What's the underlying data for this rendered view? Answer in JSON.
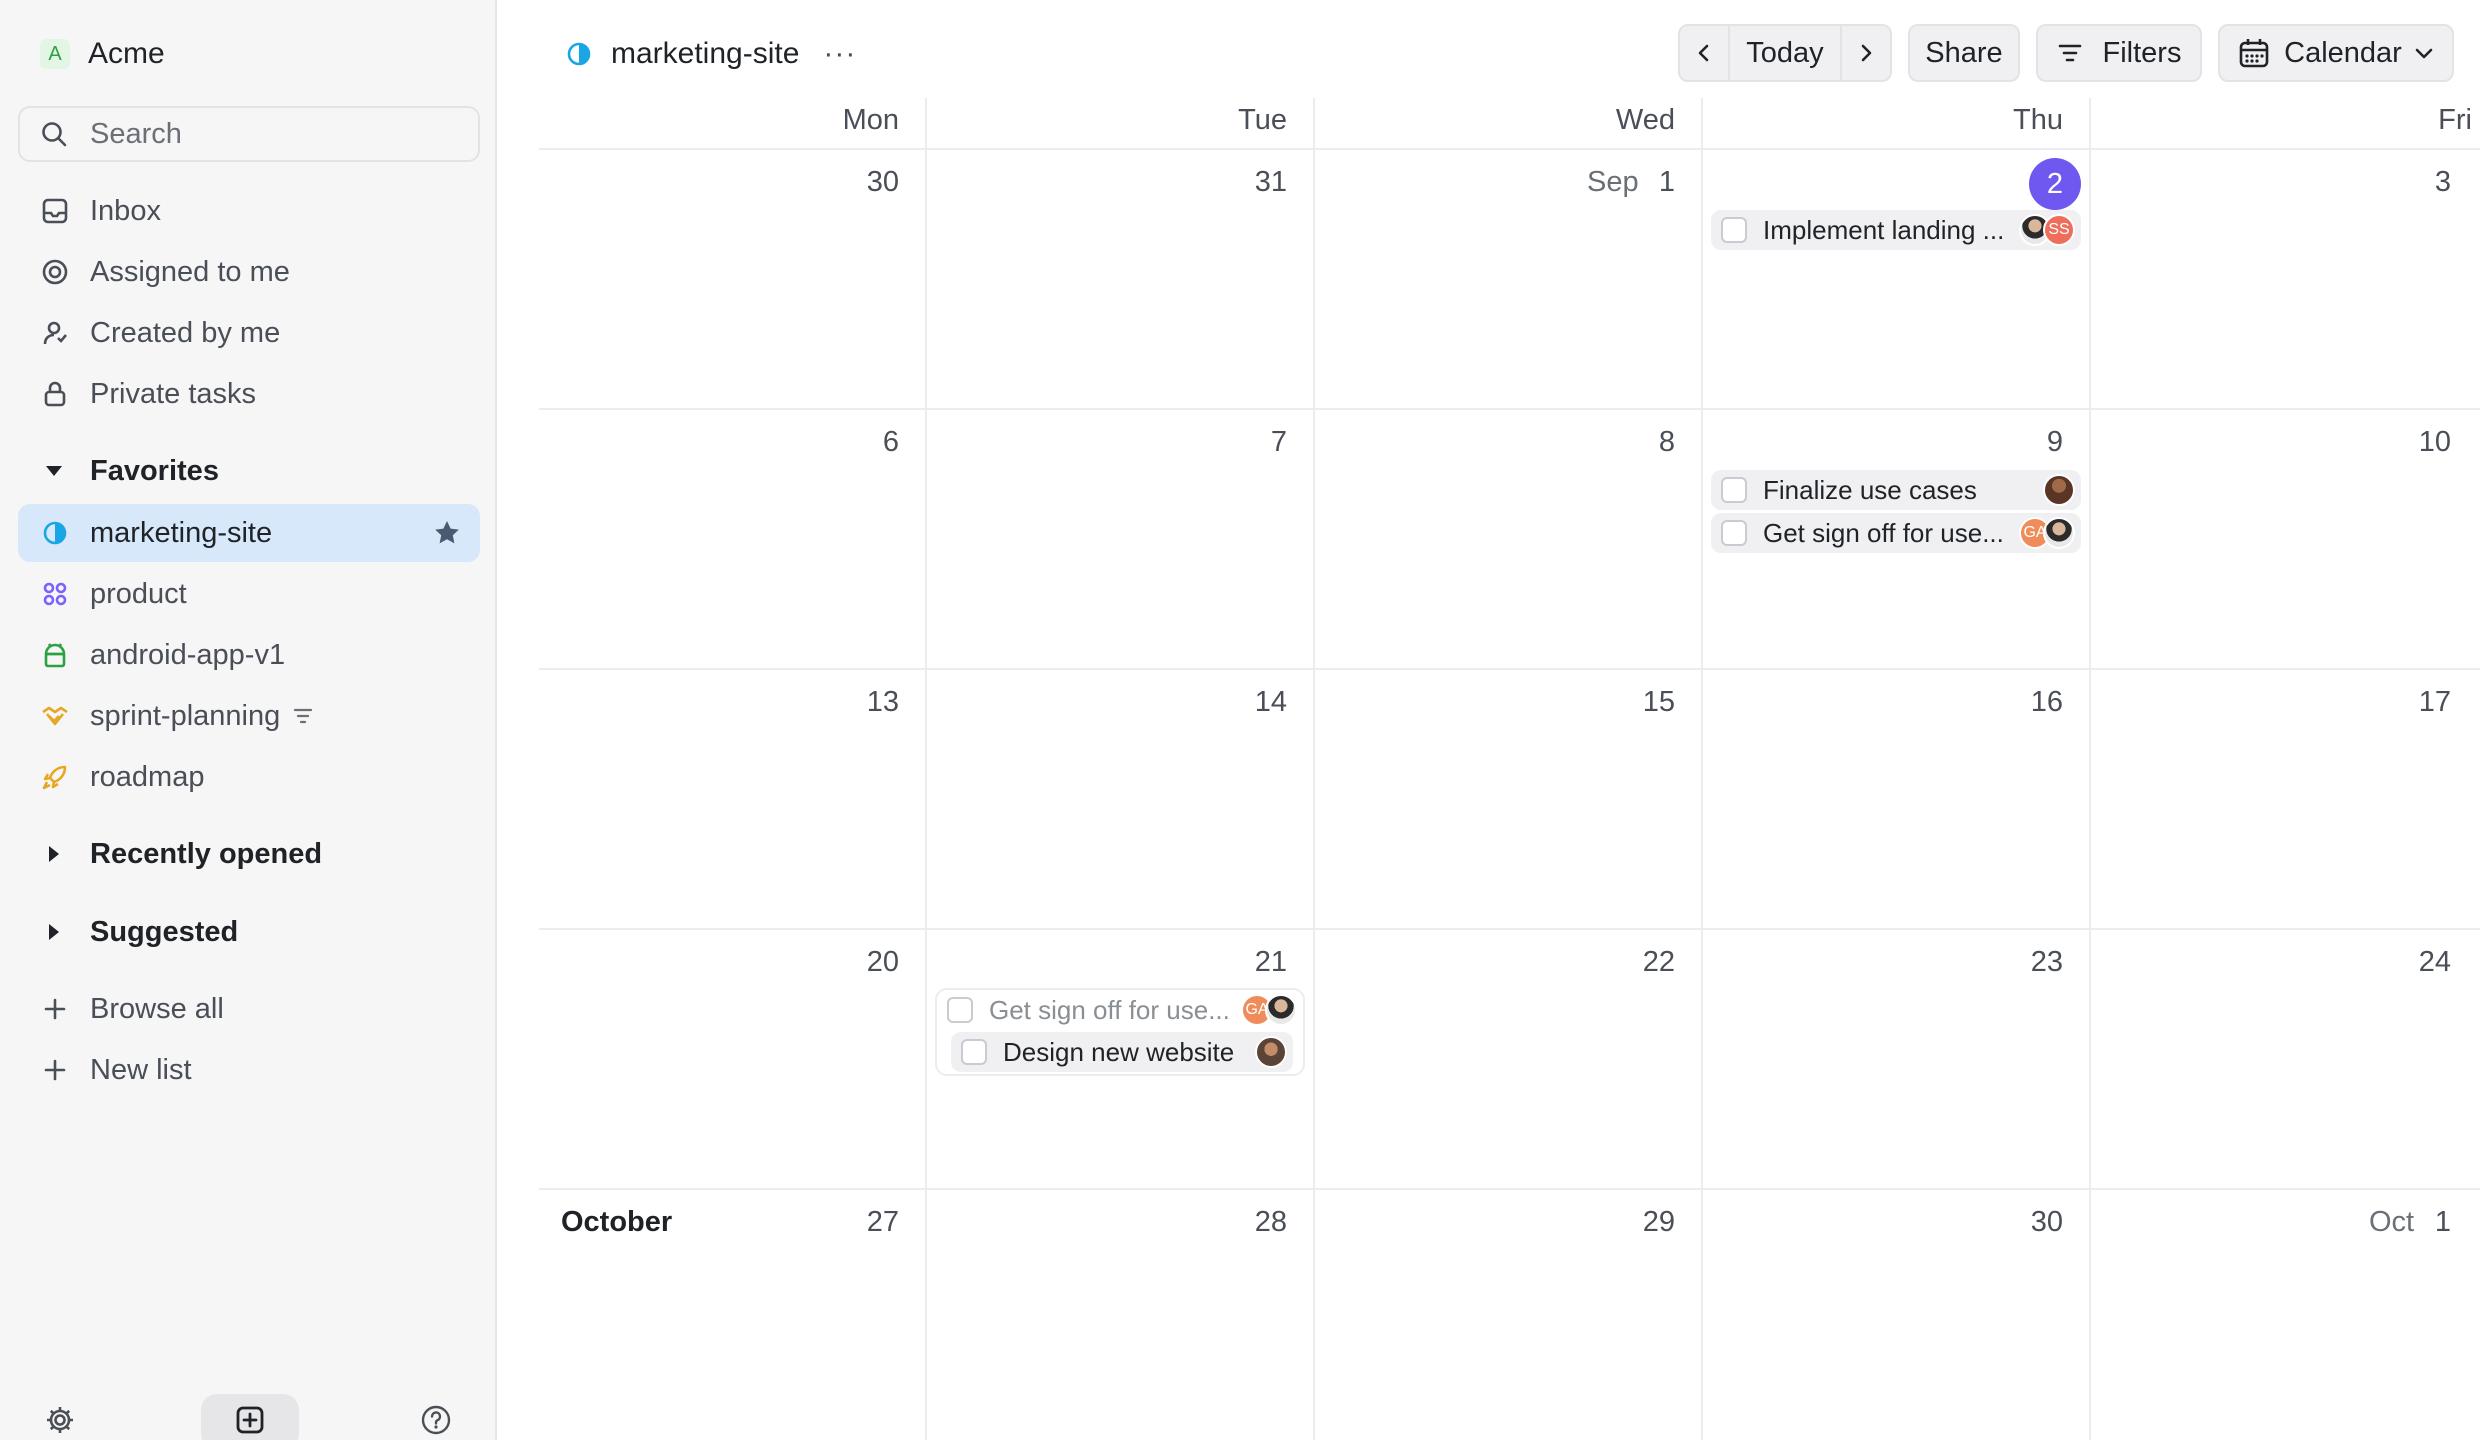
{
  "workspace": {
    "initial": "A",
    "name": "Acme"
  },
  "search": {
    "placeholder": "Search"
  },
  "nav": [
    {
      "label": "Inbox",
      "icon": "inbox-icon"
    },
    {
      "label": "Assigned to me",
      "icon": "target-icon"
    },
    {
      "label": "Created by me",
      "icon": "user-icon"
    },
    {
      "label": "Private tasks",
      "icon": "lock-icon"
    }
  ],
  "favorites": {
    "label": "Favorites",
    "items": [
      {
        "label": "marketing-site",
        "icon": "half-circle-icon",
        "color": "#1aa6e4",
        "active": true
      },
      {
        "label": "product",
        "icon": "grid-icon",
        "color": "#7b61ff"
      },
      {
        "label": "android-app-v1",
        "icon": "android-icon",
        "color": "#2aa243"
      },
      {
        "label": "sprint-planning",
        "icon": "handshake-icon",
        "color": "#e5a823"
      },
      {
        "label": "roadmap",
        "icon": "rocket-icon",
        "color": "#e5a823"
      }
    ]
  },
  "recently_opened": {
    "label": "Recently opened"
  },
  "suggested": {
    "label": "Suggested"
  },
  "actions": {
    "browse_all": "Browse all",
    "new_list": "New list"
  },
  "header": {
    "project": "marketing-site",
    "more": "···",
    "today": "Today",
    "share": "Share",
    "filters": "Filters",
    "view": "Calendar"
  },
  "calendar": {
    "weekdays": [
      "Mon",
      "Tue",
      "Wed",
      "Thu",
      "Fri"
    ],
    "weeks": [
      {
        "days": [
          "30",
          "31",
          "1",
          "2",
          "3"
        ]
      },
      {
        "days": [
          "6",
          "7",
          "8",
          "9",
          "10"
        ]
      },
      {
        "days": [
          "13",
          "14",
          "15",
          "16",
          "17"
        ]
      },
      {
        "days": [
          "20",
          "21",
          "22",
          "23",
          "24"
        ]
      },
      {
        "days": [
          "27",
          "28",
          "29",
          "30",
          "1"
        ]
      }
    ],
    "month_prefix_sep": "Sep",
    "month_prefix_oct": "Oct",
    "month_label_october": "October",
    "today_accent": "#6e58f0"
  },
  "tasks": {
    "implement_landing": {
      "title": "Implement landing ...",
      "avatars": [
        "photo",
        "SS"
      ]
    },
    "finalize_use_cases": {
      "title": "Finalize use cases",
      "avatars": [
        "photo"
      ]
    },
    "get_sign_off_thu": {
      "title": "Get sign off for use...",
      "avatars": [
        "GA",
        "photo"
      ]
    },
    "get_sign_off_tue": {
      "title": "Get sign off for use...",
      "avatars": [
        "GA",
        "photo"
      ]
    },
    "design_new_website": {
      "title": "Design new website",
      "avatars": [
        "photo"
      ]
    }
  }
}
